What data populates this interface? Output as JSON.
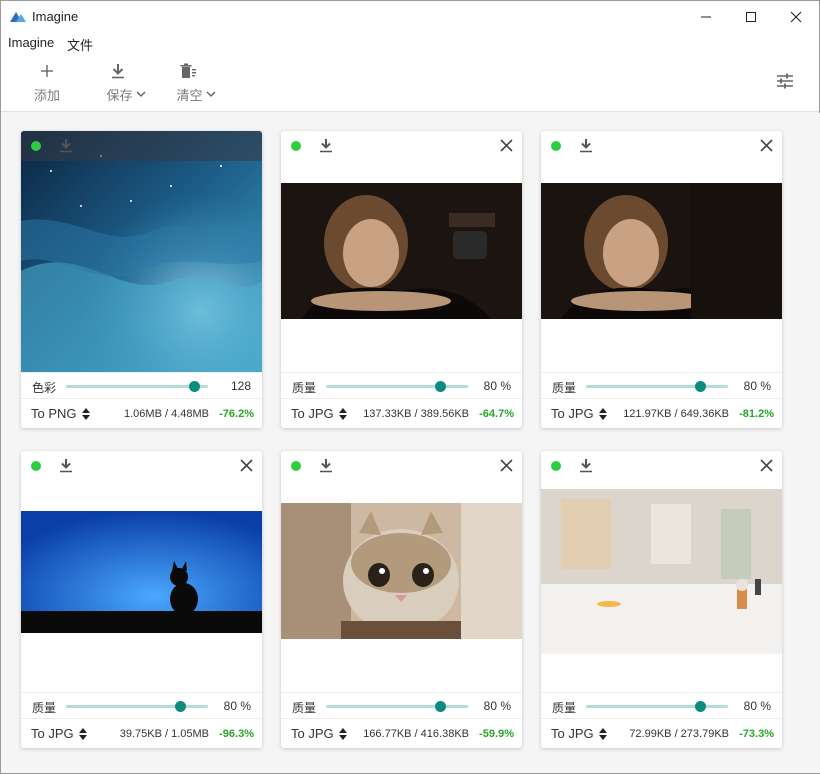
{
  "app": {
    "title": "Imagine"
  },
  "menu": {
    "items": [
      "Imagine",
      "文件"
    ]
  },
  "toolbar": {
    "add_label": "添加",
    "save_label": "保存",
    "clear_label": "清空"
  },
  "cards": [
    {
      "control_label": "色彩",
      "control_value": "128",
      "slider_level": 0.9,
      "format": "To PNG",
      "sizes": "1.06MB / 4.48MB",
      "ratio": "-76.2%",
      "image": "galaxy-image",
      "status": "done"
    },
    {
      "control_label": "质量",
      "control_value": "80 %",
      "slider_level": 0.8,
      "format": "To JPG",
      "sizes": "137.33KB / 389.56KB",
      "ratio": "-64.7%",
      "image": "portrait-ad-image",
      "status": "done"
    },
    {
      "control_label": "质量",
      "control_value": "80 %",
      "slider_level": 0.8,
      "format": "To JPG",
      "sizes": "121.97KB / 649.36KB",
      "ratio": "-81.2%",
      "image": "portrait-ad-image",
      "status": "done"
    },
    {
      "control_label": "质量",
      "control_value": "80 %",
      "slider_level": 0.8,
      "format": "To JPG",
      "sizes": "39.75KB / 1.05MB",
      "ratio": "-96.3%",
      "image": "cat-silhouette-image",
      "status": "done"
    },
    {
      "control_label": "质量",
      "control_value": "80 %",
      "slider_level": 0.8,
      "format": "To JPG",
      "sizes": "166.77KB / 416.38KB",
      "ratio": "-59.9%",
      "image": "kitten-image",
      "status": "done"
    },
    {
      "control_label": "质量",
      "control_value": "80 %",
      "slider_level": 0.8,
      "format": "To JPG",
      "sizes": "72.99KB / 273.79KB",
      "ratio": "-73.3%",
      "image": "figurines-image",
      "status": "done"
    }
  ],
  "colors": {
    "accent": "#0e8a7e",
    "slider_track": "#b3ddd6",
    "status_done": "#2ecc40",
    "ratio_text": "#2aa52a"
  }
}
